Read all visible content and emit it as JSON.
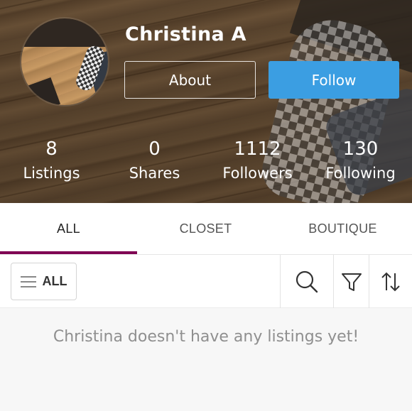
{
  "profile": {
    "name": "Christina A",
    "about_label": "About",
    "follow_label": "Follow"
  },
  "stats": [
    {
      "value": "8",
      "label": "Listings"
    },
    {
      "value": "0",
      "label": "Shares"
    },
    {
      "value": "1112",
      "label": "Followers"
    },
    {
      "value": "130",
      "label": "Following"
    }
  ],
  "tabs": [
    {
      "label": "ALL",
      "active": true
    },
    {
      "label": "CLOSET",
      "active": false
    },
    {
      "label": "BOUTIQUE",
      "active": false
    }
  ],
  "filterbar": {
    "all_label": "ALL",
    "icons": [
      "search-icon",
      "filter-icon",
      "sort-icon"
    ]
  },
  "empty_state": {
    "message": "Christina doesn't have any listings yet!"
  },
  "colors": {
    "follow_button": "#3b9ee2",
    "tab_underline": "#7f0353"
  }
}
